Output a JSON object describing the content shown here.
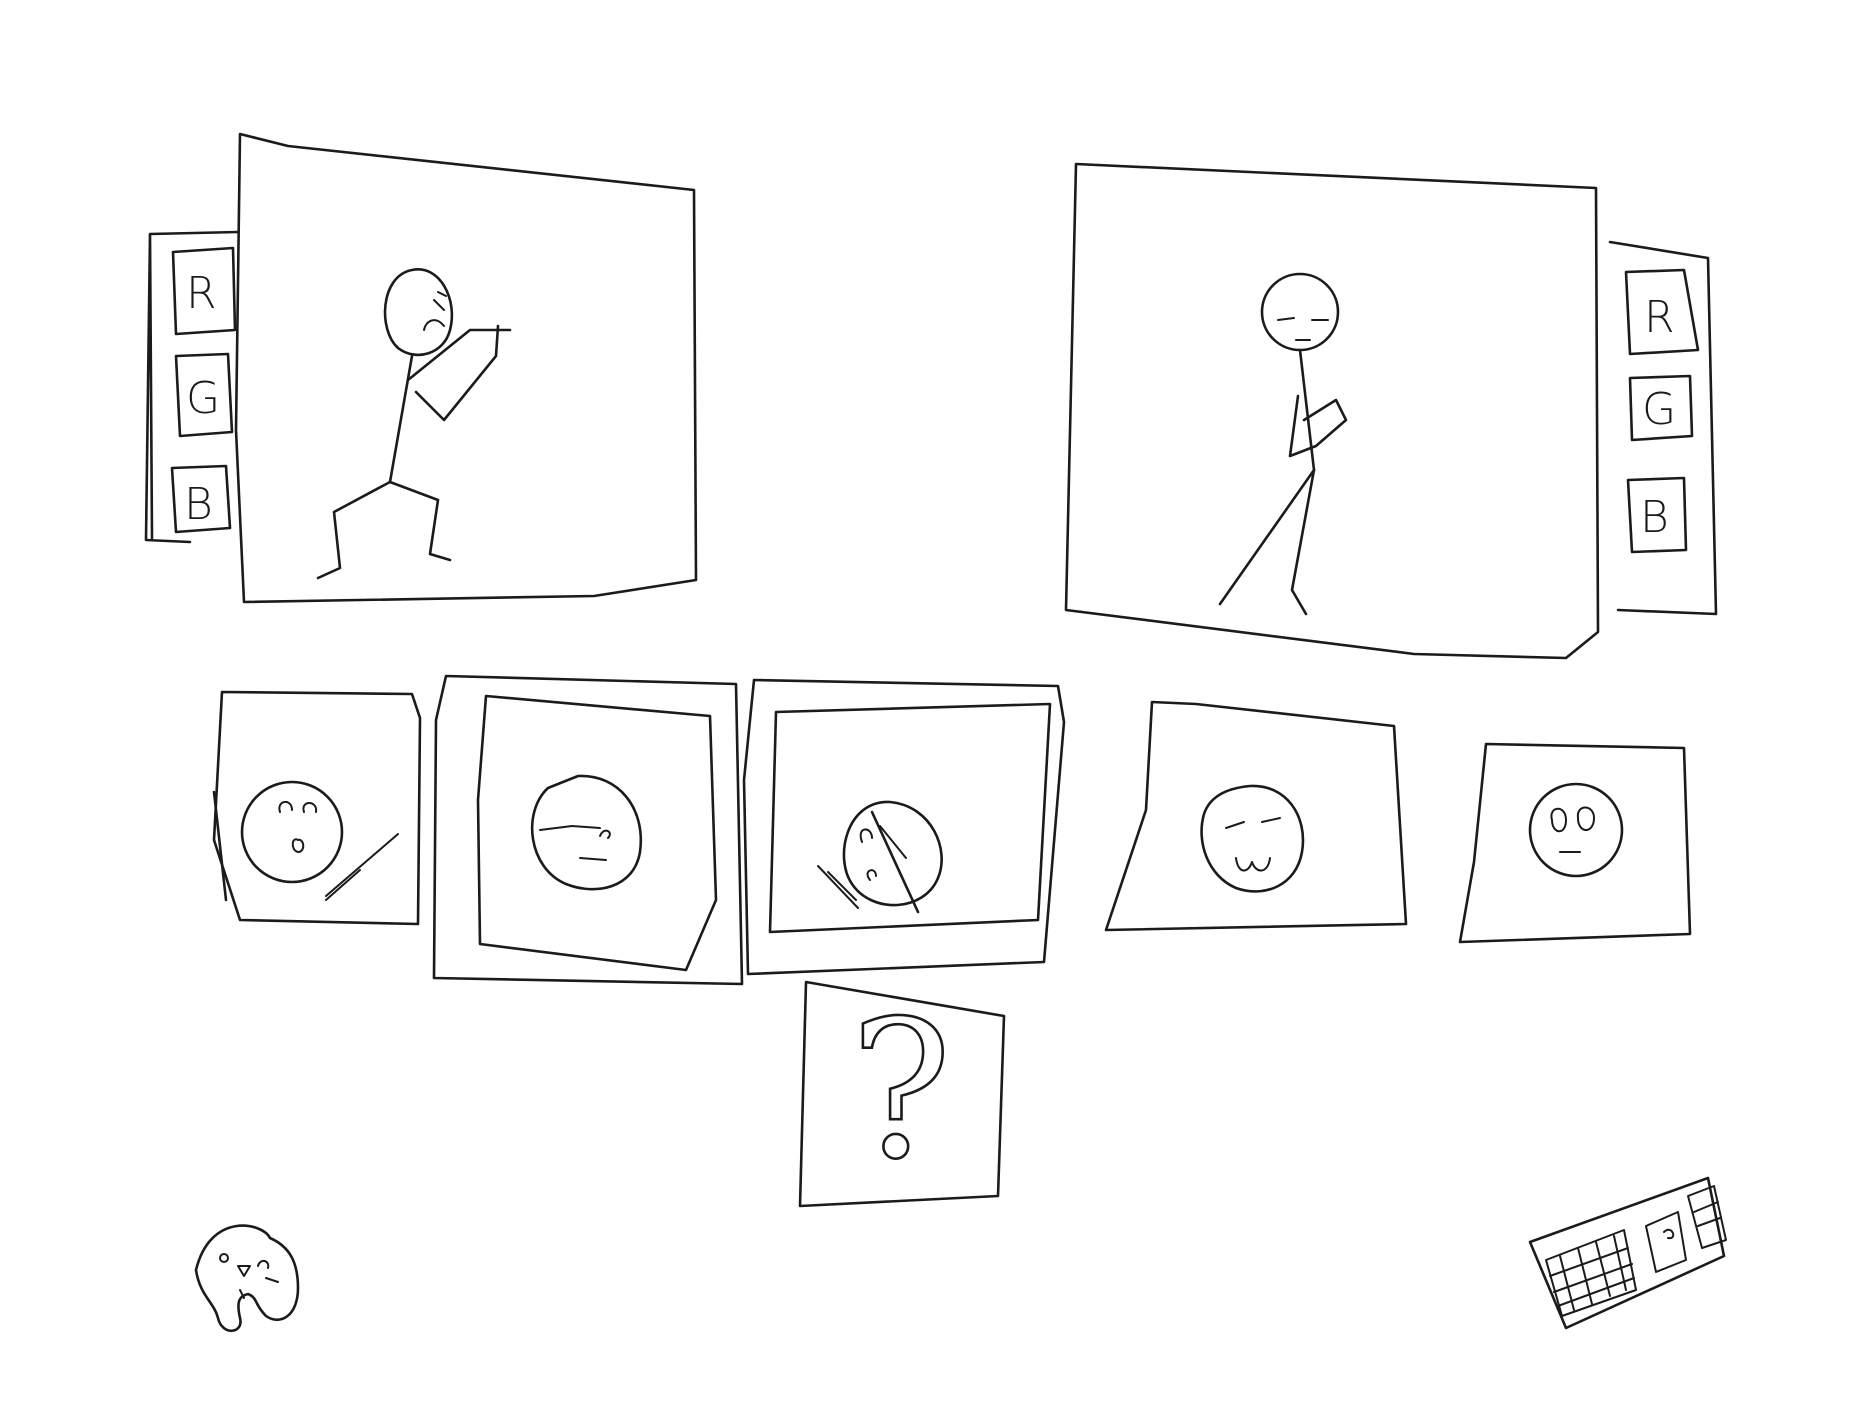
{
  "left_player": {
    "color_buttons": [
      "R",
      "G",
      "B"
    ]
  },
  "right_player": {
    "color_buttons": [
      "R",
      "G",
      "B"
    ]
  },
  "random_tile": {
    "symbol": "?"
  },
  "icons": {
    "left_corner": "gamepad-icon",
    "right_corner": "keyboard-icon"
  }
}
